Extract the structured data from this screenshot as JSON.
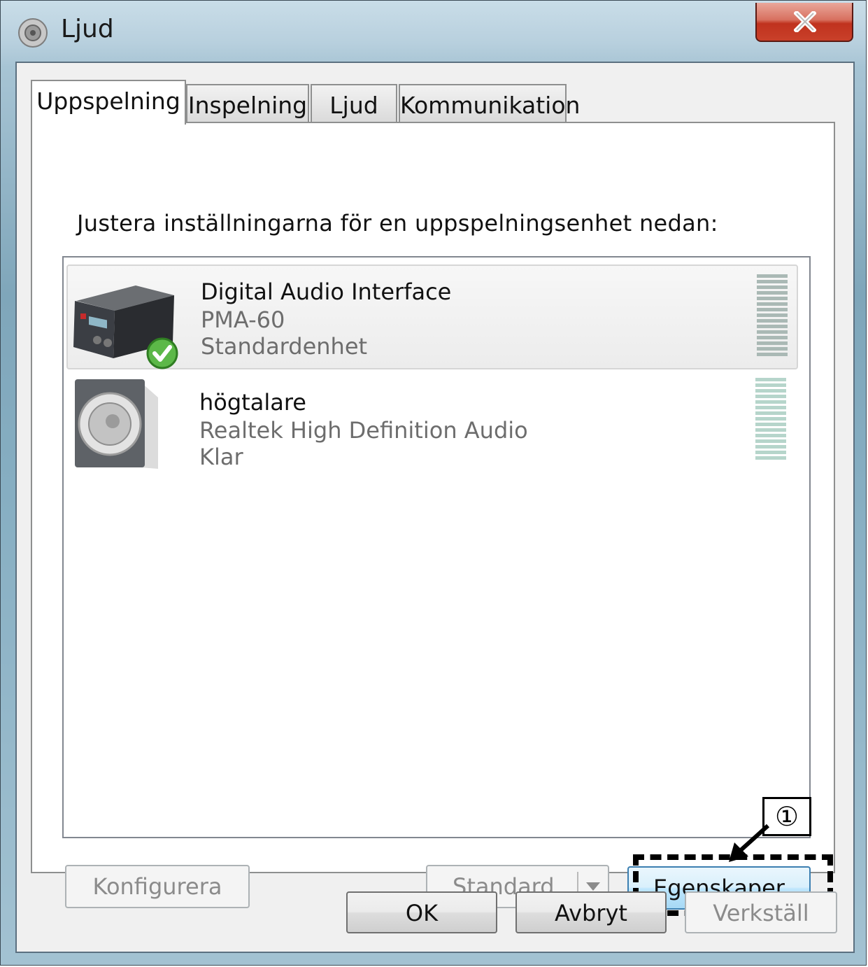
{
  "window": {
    "title": "Ljud",
    "close_label": "X"
  },
  "tabs": [
    {
      "label": "Uppspelning",
      "active": true
    },
    {
      "label": "Inspelning",
      "active": false
    },
    {
      "label": "Ljud",
      "active": false
    },
    {
      "label": "Kommunikation",
      "active": false
    }
  ],
  "instruction": "Justera inställningarna för en uppspelningsenhet nedan:",
  "devices": [
    {
      "name": "Digital Audio Interface",
      "model": "PMA-60",
      "status": "Standardenhet",
      "selected": true,
      "icon": "receiver-device-icon",
      "default_badge": "checkmark-icon"
    },
    {
      "name": "högtalare",
      "model": "Realtek High Definition Audio",
      "status": "Klar",
      "selected": false,
      "icon": "speaker-icon"
    }
  ],
  "buttons": {
    "configure": "Konfigurera",
    "set_default": "Standard",
    "properties": "Egenskaper",
    "ok": "OK",
    "cancel": "Avbryt",
    "apply": "Verkställ"
  },
  "annotation": {
    "marker": "①"
  }
}
